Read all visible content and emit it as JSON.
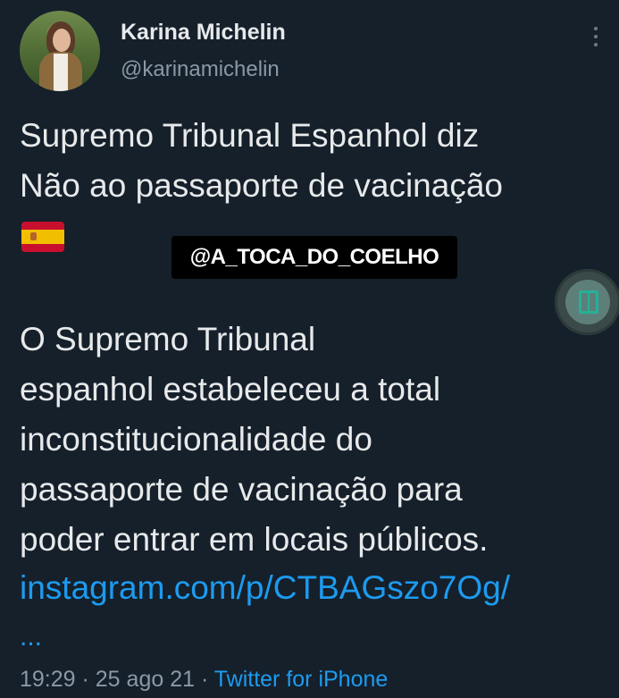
{
  "tweet": {
    "author": {
      "name": "Karina Michelin",
      "handle": "@karinamichelin"
    },
    "text": {
      "line1": "Supremo Tribunal Espanhol diz",
      "line2": "Não ao  passaporte de vacinação",
      "flag_icon": "spain-flag-icon",
      "body_lines": [
        "O Supremo Tribunal",
        "espanhol estabeleceu a total",
        "inconstitucionalidade do",
        "passaporte de vacinação para",
        "poder entrar em locais públicos."
      ],
      "link": "instagram.com/p/CTBAGszo7Og/",
      "ellipsis": "..."
    },
    "meta": {
      "time": "19:29",
      "sep1": " · ",
      "date": "25 ago 21",
      "sep2": " · ",
      "source": "Twitter for iPhone"
    }
  },
  "overlay": {
    "watermark": "@A_TOCA_DO_COELHO",
    "badge_icon": "book-icon"
  },
  "colors": {
    "background": "#15202b",
    "link": "#1d9bf0",
    "secondary_text": "#8b98a5"
  }
}
